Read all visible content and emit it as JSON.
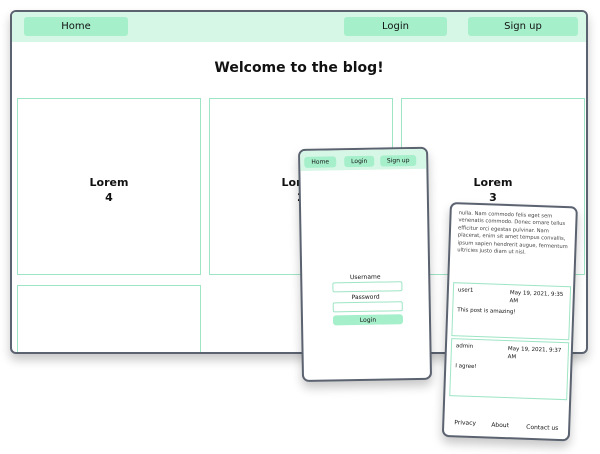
{
  "desktop": {
    "nav": {
      "home": "Home",
      "login": "Login",
      "signup": "Sign up"
    },
    "page_title": "Welcome to the blog!",
    "cards": [
      {
        "title": "Lorem",
        "number": "4"
      },
      {
        "title": "Lorem",
        "number": "2"
      },
      {
        "title": "Lorem",
        "number": "3"
      }
    ]
  },
  "mobile_login": {
    "nav": {
      "home": "Home",
      "login": "Login",
      "signup": "Sign up"
    },
    "username_label": "Username",
    "password_label": "Password",
    "login_button": "Login"
  },
  "mobile_post": {
    "body_text": "nulla. Nam commodo felis eget sem venenatis commodo. Donec ornare tellus efficitur orci egestas pulvinar. Nam placerat, enim sit amet tempus convallis, ipsum sapien hendrerit augue, fermentum ultricies justo diam ut nisl.",
    "comments": [
      {
        "user": "user1",
        "date": "May 19, 2021, 9:35 AM",
        "text": "This post is amazing!"
      },
      {
        "user": "admin",
        "date": "May 19, 2021, 9:37 AM",
        "text": "I agree!"
      }
    ],
    "footer": {
      "privacy": "Privacy",
      "about": "About",
      "contact": "Contact us"
    }
  }
}
